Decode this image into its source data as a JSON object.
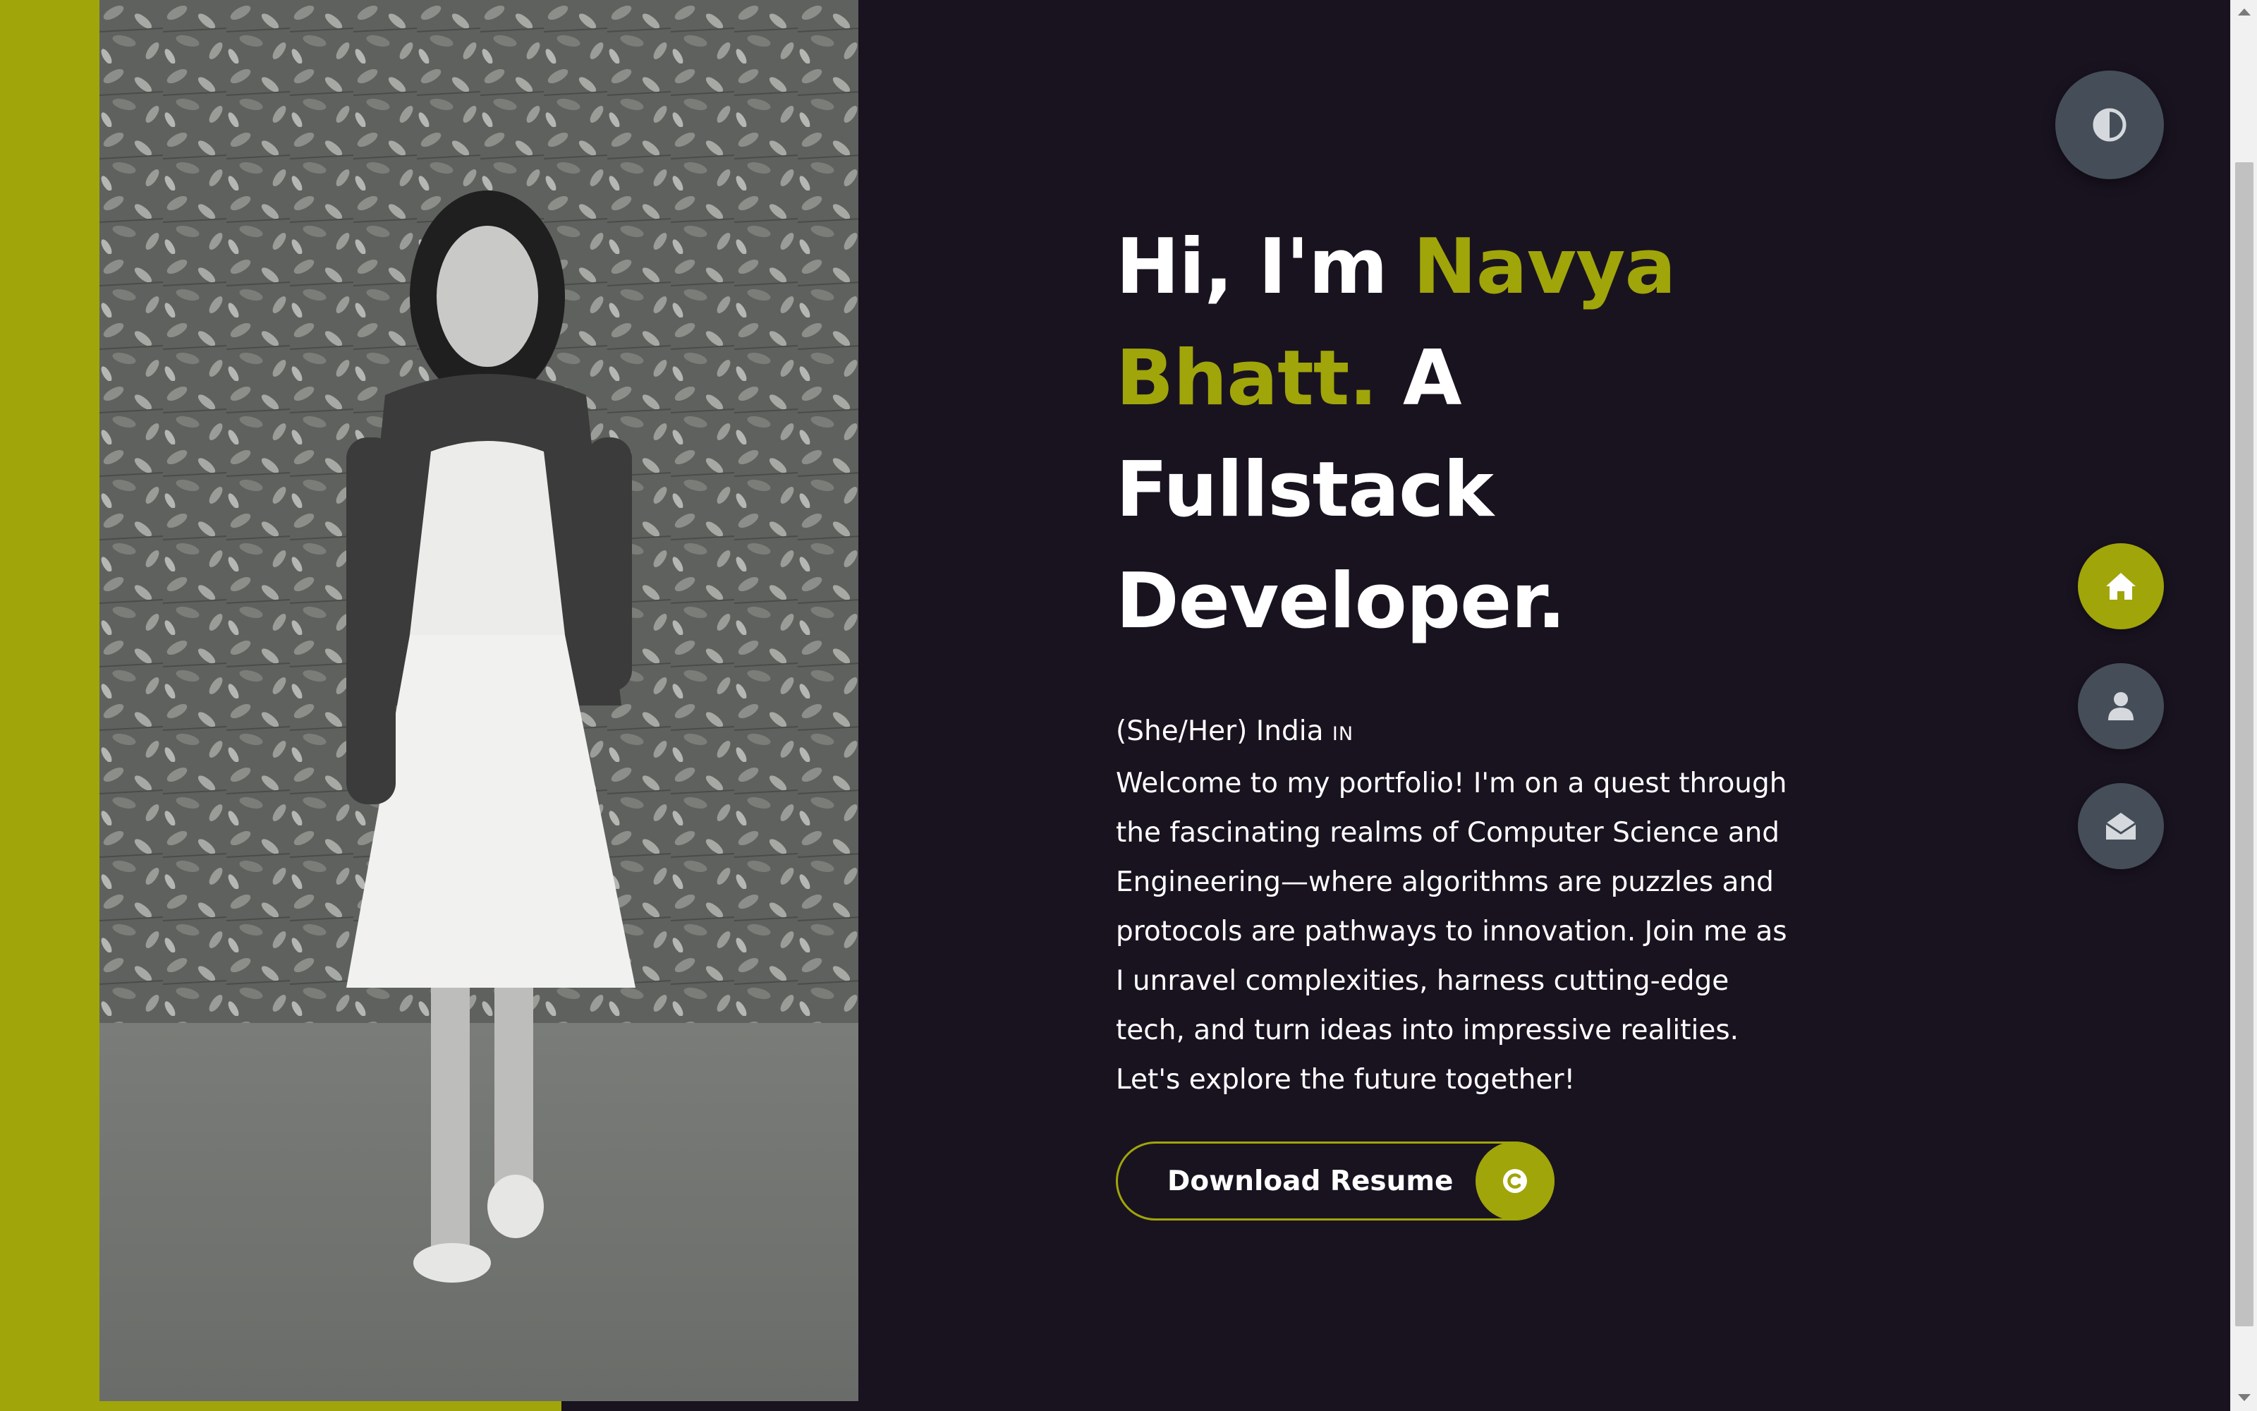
{
  "hero": {
    "greeting": "Hi, I'm ",
    "name_part1": "Navya",
    "name_part2": "Bhatt.",
    "role_part1": " A Fullstack",
    "role_part2": "Developer.",
    "pronouns_location": "(She/Her) India ",
    "flag": "IN",
    "bio": "Welcome to my portfolio! I'm on a quest through the fascinating realms of Computer Science and Engineering—where algorithms are puzzles and protocols are pathways to innovation. Join me as I unravel complexities, harness cutting-edge tech, and turn ideas into impressive realities. Let's explore the future together!"
  },
  "cta": {
    "label": "Download Resume",
    "icon": "copyright-icon"
  },
  "controls": {
    "theme_icon": "contrast-icon",
    "nav": [
      {
        "name": "home",
        "icon": "home-icon",
        "active": true
      },
      {
        "name": "about",
        "icon": "user-icon",
        "active": false
      },
      {
        "name": "contact",
        "icon": "envelope-open-icon",
        "active": false
      }
    ]
  },
  "colors": {
    "accent": "#a0a50a",
    "background": "#191320",
    "button_bg": "#454e58",
    "text": "#ffffff"
  }
}
